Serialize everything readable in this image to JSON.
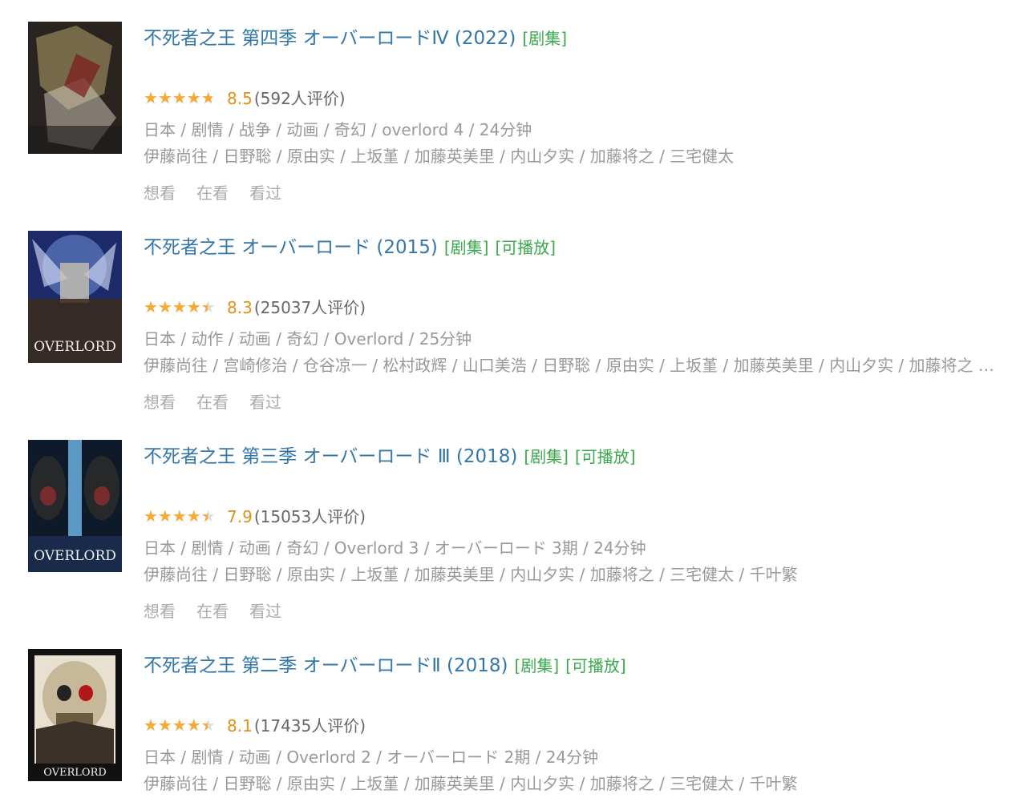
{
  "items": [
    {
      "title": "不死者之王 第四季 オーバーロードⅣ (2022)",
      "tags": [
        "[剧集]"
      ],
      "rating_fraction": 0.85,
      "score": "8.5",
      "votes": "(592人评价)",
      "meta": "日本 / 剧情 / 战争 / 动画 / 奇幻 / overlord 4 / 24分钟",
      "cast": "伊藤尚往 / 日野聡 / 原由实 / 上坂堇 / 加藤英美里 / 内山夕实 / 加藤将之 / 三宅健太",
      "actions": [
        "想看",
        "在看",
        "看过"
      ],
      "poster_colors": [
        "#2a2420",
        "#8a7a55",
        "#1a1a1a"
      ]
    },
    {
      "title": "不死者之王 オーバーロード (2015)",
      "tags": [
        "[剧集]",
        "[可播放]"
      ],
      "rating_fraction": 0.8,
      "score": "8.3",
      "votes": "(25037人评价)",
      "meta": "日本 / 动作 / 动画 / 奇幻 / Overlord / 25分钟",
      "cast": "伊藤尚往 / 宫崎修治 / 仓谷凉一 / 松村政辉 / 山口美浩 / 日野聡 / 原由实 / 上坂堇 / 加藤英美里 / 内山夕实 / 加藤将之 / 三宅健太",
      "actions": [
        "想看",
        "在看",
        "看过"
      ],
      "poster_colors": [
        "#1c2a6a",
        "#6a8ad0",
        "#3a2a1a"
      ],
      "poster_logo": "OVERLORD"
    },
    {
      "title": "不死者之王 第三季 オーバーロード Ⅲ (2018)",
      "tags": [
        "[剧集]",
        "[可播放]"
      ],
      "rating_fraction": 0.8,
      "score": "7.9",
      "votes": "(15053人评价)",
      "meta": "日本 / 剧情 / 动画 / 奇幻 / Overlord 3 / オーバーロード 3期 / 24分钟",
      "cast": "伊藤尚往 / 日野聡 / 原由实 / 上坂堇 / 加藤英美里 / 内山夕实 / 加藤将之 / 三宅健太 / 千叶繁",
      "actions": [
        "想看",
        "在看",
        "看过"
      ],
      "poster_colors": [
        "#0e1a2a",
        "#6ab0e0",
        "#2a2a2a"
      ],
      "poster_logo": "OVERLORD"
    },
    {
      "title": "不死者之王 第二季 オーバーロードⅡ (2018)",
      "tags": [
        "[剧集]",
        "[可播放]"
      ],
      "rating_fraction": 0.8,
      "score": "8.1",
      "votes": "(17435人评价)",
      "meta": "日本 / 剧情 / 动画 / Overlord 2 / オーバーロード 2期 / 24分钟",
      "cast": "伊藤尚往 / 日野聡 / 原由实 / 上坂堇 / 加藤英美里 / 内山夕实 / 加藤将之 / 三宅健太 / 千叶繁",
      "actions": [
        "想看",
        "在看",
        "看过"
      ],
      "poster_colors": [
        "#111111",
        "#c8b89a",
        "#e8e0d0"
      ],
      "poster_logo": "OVERLORD"
    }
  ]
}
